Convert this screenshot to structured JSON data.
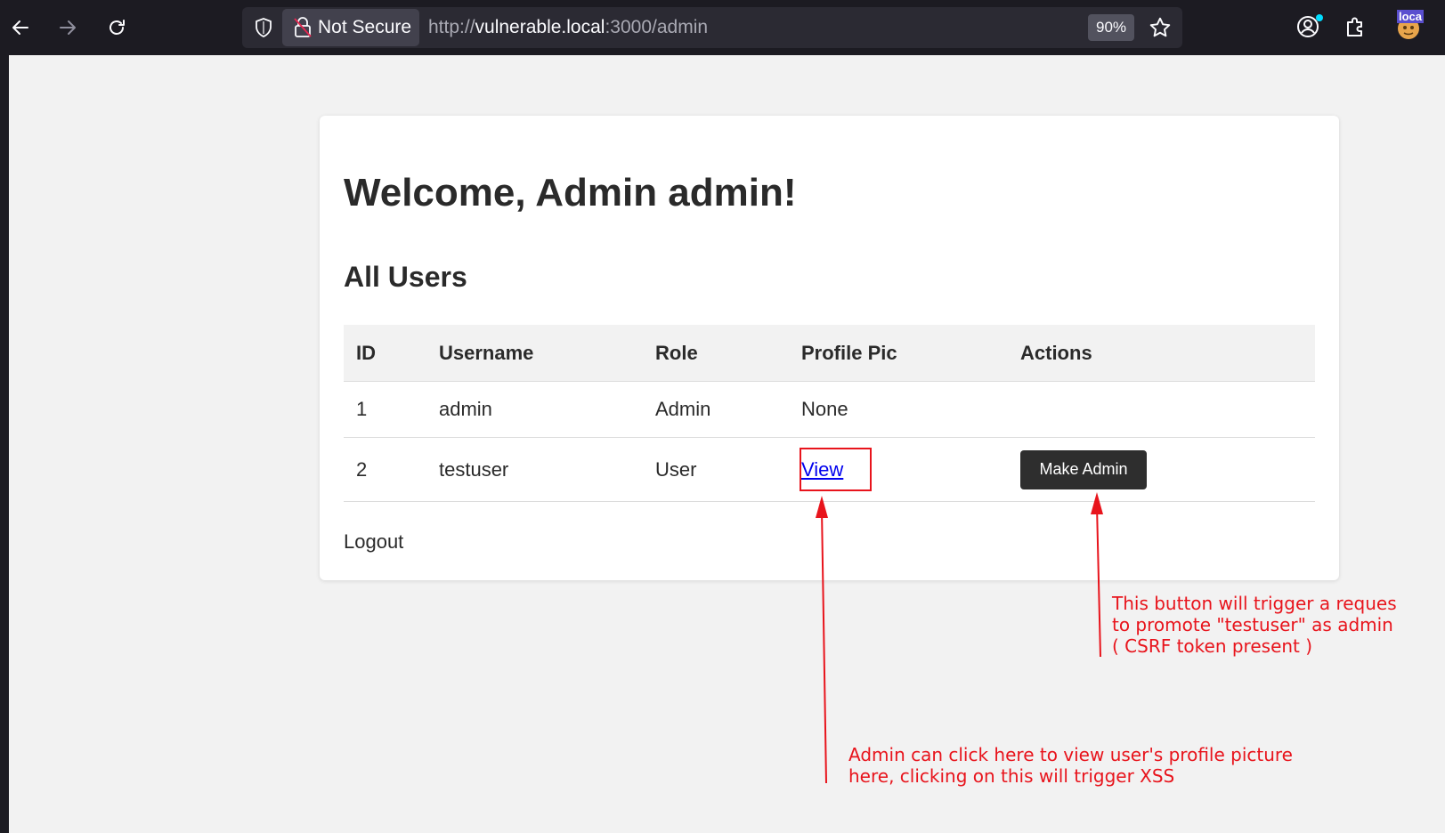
{
  "browser": {
    "security_label": "Not Secure",
    "url_scheme": "http://",
    "url_host": "vulnerable.local",
    "url_path": ":3000/admin",
    "zoom": "90%",
    "extension_label": "loca"
  },
  "icons": {
    "back": "arrow-left-icon",
    "forward": "arrow-right-icon",
    "reload": "reload-icon",
    "shield": "shield-icon",
    "lock": "broken-lock-icon",
    "bookmark": "star-icon",
    "account": "account-icon",
    "extensions": "puzzle-icon"
  },
  "page": {
    "welcome": "Welcome, Admin admin!",
    "section_title": "All Users",
    "logout": "Logout"
  },
  "table": {
    "headers": [
      "ID",
      "Username",
      "Role",
      "Profile Pic",
      "Actions"
    ],
    "rows": [
      {
        "id": "1",
        "username": "admin",
        "role": "Admin",
        "profile_pic": "None",
        "action": ""
      },
      {
        "id": "2",
        "username": "testuser",
        "role": "User",
        "profile_pic": "View",
        "action": "Make Admin"
      }
    ]
  },
  "annotations": {
    "note_button": "This button will trigger a reques\nto promote \"testuser\" as admin\n( CSRF token present )",
    "note_view": "Admin can click here to view user's profile picture\nhere, clicking on this will trigger XSS",
    "color": "#e8141c"
  },
  "colors": {
    "chrome_bg": "#1c1b22",
    "urlbar_bg": "#2b2a33",
    "button_dark": "#2e2e2e",
    "link": "#0000ee"
  }
}
